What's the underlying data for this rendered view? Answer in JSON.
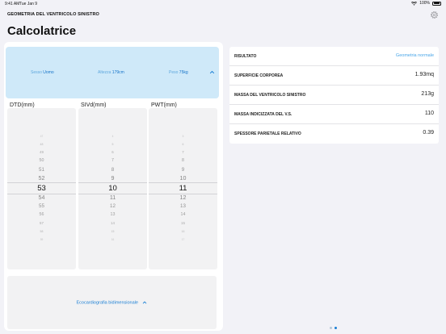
{
  "status": {
    "time": "9:41 AM",
    "date": "Tue Jan 9",
    "battery": "100%",
    "battery_level": 1.0
  },
  "header": {
    "app_name": "GEOMETRIA DEL VENTRICOLO SINISTRO",
    "title": "Calcolatrice",
    "settings_icon": "gear-icon"
  },
  "params": [
    {
      "label": "Sesso",
      "value": "Uomo"
    },
    {
      "label": "Altezza",
      "value": "179cm"
    },
    {
      "label": "Peso",
      "value": "75kg"
    }
  ],
  "pickers": [
    {
      "header": "DTD(mm)",
      "values": [
        "47",
        "48",
        "49",
        "50",
        "51",
        "52",
        "53",
        "54",
        "55",
        "56",
        "57",
        "58",
        "59"
      ],
      "selected": "53"
    },
    {
      "header": "SIVd(mm)",
      "values": [
        "4",
        "5",
        "6",
        "7",
        "8",
        "9",
        "10",
        "11",
        "12",
        "13",
        "14",
        "15",
        "16"
      ],
      "selected": "10"
    },
    {
      "header": "PWT(mm)",
      "values": [
        "5",
        "6",
        "7",
        "8",
        "9",
        "10",
        "11",
        "12",
        "13",
        "14",
        "15",
        "16",
        "17"
      ],
      "selected": "11"
    }
  ],
  "echo_button": "Ecocardiografia bidimensionale",
  "results": [
    {
      "label": "RISULTATO",
      "value": "Geometria normale",
      "link": true
    },
    {
      "label": "SUPERFICIE CORPOREA",
      "value": "1.93mq"
    },
    {
      "label": "MASSA DEL VENTRICOLO SINISTRO",
      "value": "213g"
    },
    {
      "label": "MASSA INDICIZZATA DEL V.S.",
      "value": "110"
    },
    {
      "label": "SPESSORE PARIETALE RELATIVO",
      "value": "0.39"
    }
  ],
  "page_indicator": {
    "count": 2,
    "current": 2
  }
}
